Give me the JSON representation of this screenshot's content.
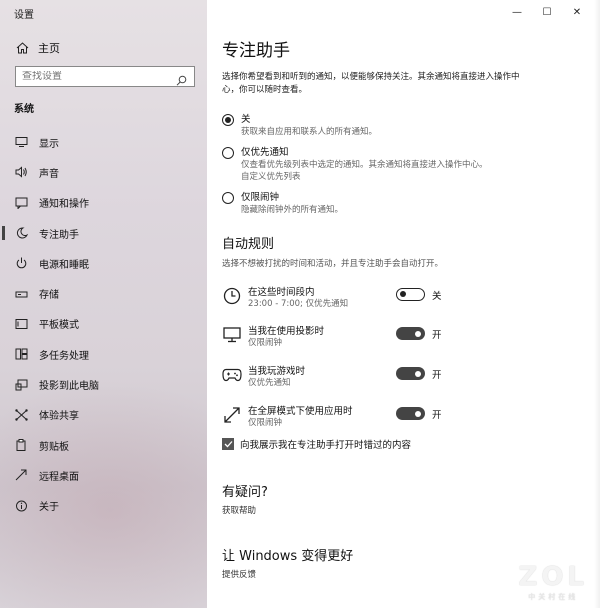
{
  "app": {
    "title": "设置"
  },
  "window_controls": {
    "minimize": "—",
    "maximize": "☐",
    "close": "✕"
  },
  "sidebar": {
    "home": "主页",
    "search_placeholder": "查找设置",
    "section": "系统",
    "items": [
      {
        "label": "显示",
        "icon": "monitor-icon"
      },
      {
        "label": "声音",
        "icon": "speaker-icon"
      },
      {
        "label": "通知和操作",
        "icon": "notification-icon"
      },
      {
        "label": "专注助手",
        "icon": "moon-icon",
        "active": true
      },
      {
        "label": "电源和睡眠",
        "icon": "power-icon"
      },
      {
        "label": "存储",
        "icon": "storage-icon"
      },
      {
        "label": "平板模式",
        "icon": "tablet-icon"
      },
      {
        "label": "多任务处理",
        "icon": "multitask-icon"
      },
      {
        "label": "投影到此电脑",
        "icon": "project-icon"
      },
      {
        "label": "体验共享",
        "icon": "share-icon"
      },
      {
        "label": "剪贴板",
        "icon": "clipboard-icon"
      },
      {
        "label": "远程桌面",
        "icon": "remote-icon"
      },
      {
        "label": "关于",
        "icon": "info-icon"
      }
    ]
  },
  "main": {
    "title": "专注助手",
    "description": "选择你希望看到和听到的通知，以便能够保持关注。其余通知将直接进入操作中心，你可以随时查看。",
    "options": [
      {
        "label": "关",
        "sub": "获取来自应用和联系人的所有通知。",
        "selected": true
      },
      {
        "label": "仅优先通知",
        "sub": "仅查看优先级列表中选定的通知。其余通知将直接进入操作中心。",
        "link": "自定义优先列表",
        "selected": false
      },
      {
        "label": "仅限闹钟",
        "sub": "隐藏除闹钟外的所有通知。",
        "selected": false
      }
    ],
    "auto_rules_title": "自动规则",
    "auto_rules_desc": "选择不想被打扰的时间和活动，并且专注助手会自动打开。",
    "rules": [
      {
        "name": "在这些时间段内",
        "sub": "23:00 - 7:00; 仅优先通知",
        "state": "关",
        "on": false,
        "icon": "clock-icon"
      },
      {
        "name": "当我在使用投影时",
        "sub": "仅限闹钟",
        "state": "开",
        "on": true,
        "icon": "display-icon"
      },
      {
        "name": "当我玩游戏时",
        "sub": "仅优先通知",
        "state": "开",
        "on": true,
        "icon": "gamepad-icon"
      },
      {
        "name": "在全屏模式下使用应用时",
        "sub": "仅限闹钟",
        "state": "开",
        "on": true,
        "icon": "fullscreen-icon"
      }
    ],
    "summary_checkbox": "向我展示我在专注助手打开时错过的内容",
    "qa_title": "有疑问?",
    "qa_link": "获取帮助",
    "better_title": "让 Windows 变得更好",
    "feedback_link": "提供反馈"
  },
  "watermark": {
    "big": "ZOL",
    "small": "中关村在线"
  }
}
